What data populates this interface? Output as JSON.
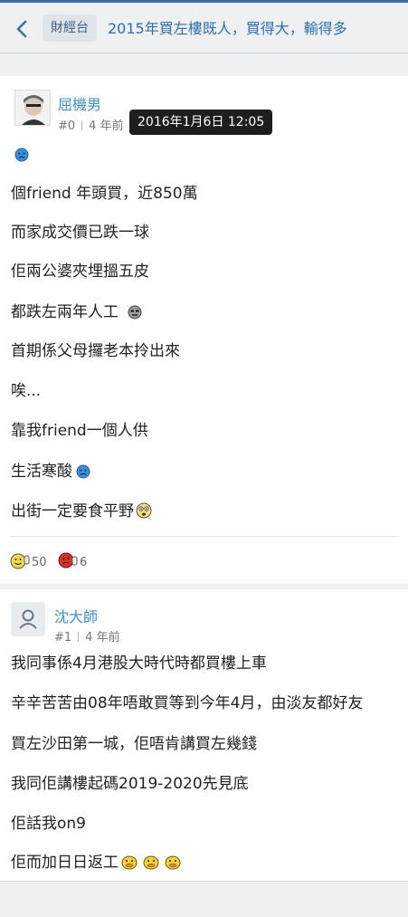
{
  "header": {
    "category": "財經台",
    "title": "2015年買左樓既人，買得大，輸得多"
  },
  "posts": [
    {
      "author": "屈機男",
      "index": "#0",
      "time": "4 年前",
      "tooltip": "2016年1月6日 12:05",
      "lines": [
        "",
        "個friend 年頭買，近850萬",
        "而家成交價已跌一球",
        "佢兩公婆夾埋搵五皮",
        "都跌左兩年人工",
        "首期係父母攞老本拎出來",
        "唉...",
        "靠我friend一個人供",
        "生活寒酸",
        "出街一定要食平野"
      ],
      "likes": "50",
      "dislikes": "6"
    },
    {
      "author": "沈大師",
      "index": "#1",
      "time": "4 年前",
      "lines": [
        "我同事係4月港股大時代時都買樓上車",
        "辛辛苦苦由08年唔敢買等到今年4月，由淡友都好友",
        "買左沙田第一城，佢唔肯講買左幾錢",
        "我同佢講樓起碼2019-2020先見底",
        "佢話我on9",
        "佢而加日日返工"
      ]
    }
  ],
  "colors": {
    "accent": "#3f8fc9",
    "tooltip_bg": "#1e1e1e"
  }
}
